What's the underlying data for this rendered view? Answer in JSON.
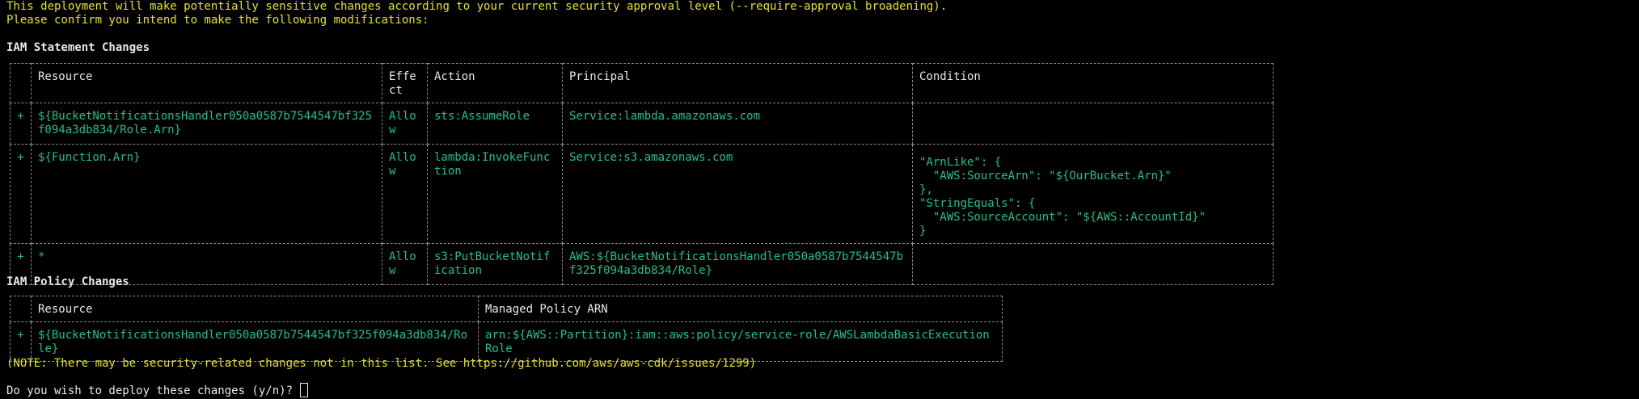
{
  "header": {
    "line1": "This deployment will make potentially sensitive changes according to your current security approval level (--require-approval broadening).",
    "line2": "Please confirm you intend to make the following modifications:"
  },
  "iam_statements": {
    "title": "IAM Statement Changes",
    "columns": [
      "",
      "Resource",
      "Effect",
      "Action",
      "Principal",
      "Condition"
    ],
    "rows": [
      {
        "sign": "+",
        "resource": "${BucketNotificationsHandler050a0587b7544547bf325f094a3db834/Role.Arn}",
        "effect": "Allow",
        "action": "sts:AssumeRole",
        "principal": "Service:lambda.amazonaws.com",
        "condition": ""
      },
      {
        "sign": "+",
        "resource": "${Function.Arn}",
        "effect": "Allow",
        "action": "lambda:InvokeFunction",
        "principal": "Service:s3.amazonaws.com",
        "condition": "\"ArnLike\": {\n  \"AWS:SourceArn\": \"${OurBucket.Arn}\"\n},\n\"StringEquals\": {\n  \"AWS:SourceAccount\": \"${AWS::AccountId}\"\n}"
      },
      {
        "sign": "+",
        "resource": "*",
        "effect": "Allow",
        "action": "s3:PutBucketNotification",
        "principal": "AWS:${BucketNotificationsHandler050a0587b7544547bf325f094a3db834/Role}",
        "condition": ""
      }
    ]
  },
  "iam_policies": {
    "title": "IAM Policy Changes",
    "columns": [
      "",
      "Resource",
      "Managed Policy ARN"
    ],
    "rows": [
      {
        "sign": "+",
        "resource": "${BucketNotificationsHandler050a0587b7544547bf325f094a3db834/Role}",
        "arn": "arn:${AWS::Partition}:iam::aws:policy/service-role/AWSLambdaBasicExecutionRole"
      }
    ]
  },
  "note": "(NOTE: There may be security-related changes not in this list. See https://github.com/aws/aws-cdk/issues/1299)",
  "prompt": "Do you wish to deploy these changes (y/n)? ",
  "colors": {
    "background": "#000000",
    "warning": "#e5e510",
    "added": "#19c489",
    "text": "#e8e8e8",
    "border": "#8a8a8a"
  }
}
